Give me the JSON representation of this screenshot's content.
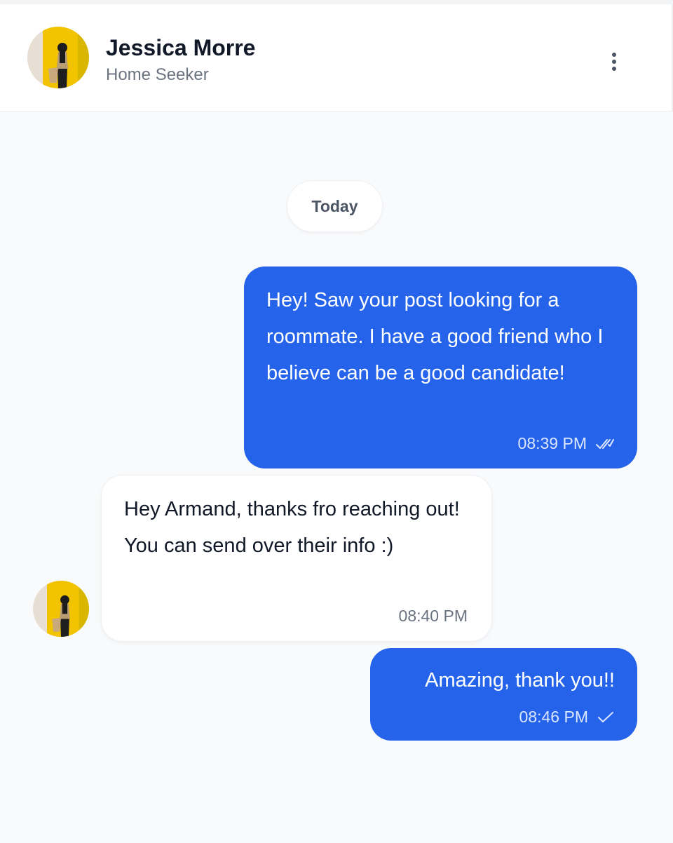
{
  "header": {
    "contact_name": "Jessica Morre",
    "contact_role": "Home Seeker",
    "menu_icon": "more-vertical-icon"
  },
  "chat": {
    "date_divider": "Today",
    "messages": [
      {
        "direction": "outgoing",
        "text": "Hey! Saw your post looking for a roommate. I have a good friend who I believe can be a good candidate!",
        "time": "08:39 PM",
        "status": "read",
        "status_icon": "double-check-icon"
      },
      {
        "direction": "incoming",
        "text": "Hey Armand, thanks fro reaching out! You can send over their info :)",
        "time": "08:40 PM"
      },
      {
        "direction": "outgoing",
        "text": "Amazing, thank you!!",
        "time": "08:46 PM",
        "status": "sent",
        "status_icon": "check-icon"
      }
    ]
  },
  "colors": {
    "outgoing_bubble": "#2563eb",
    "incoming_bubble": "#ffffff",
    "background": "#f9fafb",
    "avatar_background": "#f2c400"
  }
}
